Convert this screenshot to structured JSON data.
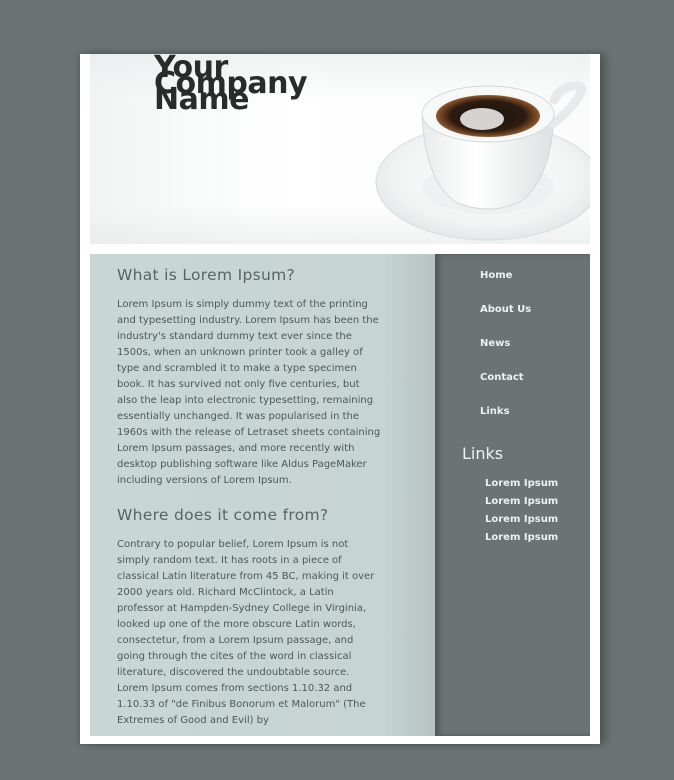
{
  "header": {
    "logo_line1": "Your",
    "logo_line2": "Company",
    "logo_line3": "Name"
  },
  "main": {
    "section1": {
      "heading": "What is Lorem Ipsum?",
      "body": "Lorem Ipsum is simply dummy text of the printing and typesetting industry. Lorem Ipsum has been the industry's standard dummy text ever since the 1500s, when an unknown printer took a galley of type and scrambled it to make a type specimen book. It has survived not only five centuries, but also the leap into electronic typesetting, remaining essentially unchanged. It was popularised in the 1960s with the release of Letraset sheets containing Lorem Ipsum passages, and more recently with desktop publishing software like Aldus PageMaker including versions of Lorem Ipsum."
    },
    "section2": {
      "heading": "Where does it come from?",
      "body": "Contrary to popular belief, Lorem Ipsum is not simply random text. It has roots in a piece of classical Latin literature from 45 BC, making it over 2000 years old. Richard McClintock, a Latin professor at Hampden-Sydney College in Virginia, looked up one of the more obscure Latin words, consectetur, from a Lorem Ipsum passage, and going through the cites of the word in classical literature, discovered the undoubtable source. Lorem Ipsum comes from sections 1.10.32 and 1.10.33 of \"de Finibus Bonorum et Malorum\" (The Extremes of Good and Evil) by"
    }
  },
  "sidebar": {
    "nav": [
      "Home",
      "About Us",
      "News",
      "Contact",
      "Links"
    ],
    "links_heading": "Links",
    "links": [
      "Lorem Ipsum",
      "Lorem Ipsum",
      "Lorem Ipsum",
      "Lorem Ipsum"
    ]
  },
  "colors": {
    "background": "#6b7374",
    "content_bg": "#c9d6d6",
    "sidebar_bg": "#6b7374",
    "heading": "#5a6464",
    "text": "#4f5757"
  },
  "icons": {
    "header_image": "coffee-cup-image"
  }
}
